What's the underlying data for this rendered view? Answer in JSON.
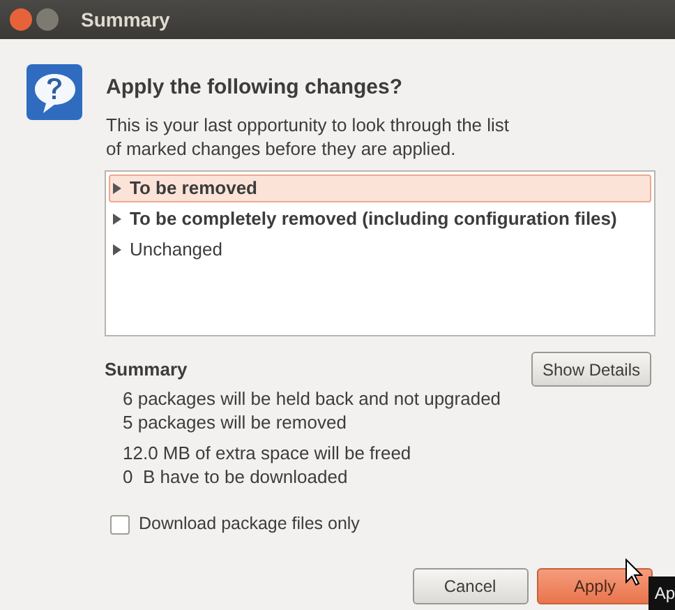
{
  "window": {
    "title": "Summary"
  },
  "heading": "Apply the following changes?",
  "description": "This is your last opportunity to look through the list of marked changes before they are applied.",
  "changes": [
    {
      "label": "To be removed",
      "selected": true,
      "bold": true
    },
    {
      "label": "To be completely removed (including configuration files)",
      "selected": false,
      "bold": true
    },
    {
      "label": "Unchanged",
      "selected": false,
      "bold": false
    }
  ],
  "summary": {
    "title": "Summary",
    "details_button": "Show Details",
    "groups": [
      [
        "6 packages will be held back and not upgraded",
        "5 packages will be removed"
      ],
      [
        "12.0 MB of extra space will be freed",
        "0  B have to be downloaded"
      ]
    ]
  },
  "download_only": {
    "label": "Download package files only",
    "checked": false
  },
  "buttons": [
    {
      "label": "Cancel",
      "kind": "normal"
    },
    {
      "label": "Apply",
      "kind": "default"
    }
  ],
  "tooltip": "Ap"
}
